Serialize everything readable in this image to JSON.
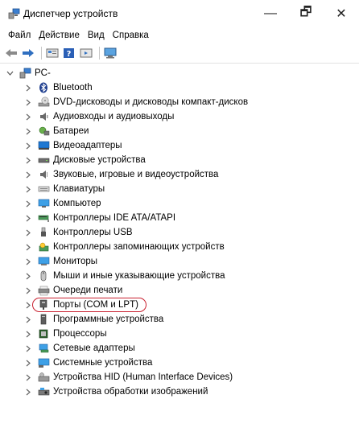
{
  "window": {
    "title": "Диспетчер устройств",
    "controls": {
      "minimize": "—",
      "maximize": "🗗",
      "close": "✕"
    }
  },
  "menu": [
    "Файл",
    "Действие",
    "Вид",
    "Справка"
  ],
  "toolbar": {
    "icons": [
      "back-arrow-icon",
      "forward-arrow-icon",
      "properties-icon",
      "help-icon",
      "update-driver-icon",
      "scan-hardware-icon"
    ]
  },
  "tree": {
    "root": {
      "label": "PC-",
      "expanded": true
    },
    "items": [
      {
        "label": "Bluetooth",
        "icon": "bluetooth-icon"
      },
      {
        "label": "DVD-дисководы и дисководы компакт-дисков",
        "icon": "dvd-drive-icon"
      },
      {
        "label": "Аудиовходы и аудиовыходы",
        "icon": "speaker-icon"
      },
      {
        "label": "Батареи",
        "icon": "battery-icon"
      },
      {
        "label": "Видеоадаптеры",
        "icon": "display-adapter-icon"
      },
      {
        "label": "Дисковые устройства",
        "icon": "disk-drive-icon"
      },
      {
        "label": "Звуковые, игровые и видеоустройства",
        "icon": "sound-device-icon"
      },
      {
        "label": "Клавиатуры",
        "icon": "keyboard-icon"
      },
      {
        "label": "Компьютер",
        "icon": "computer-icon"
      },
      {
        "label": "Контроллеры IDE ATA/ATAPI",
        "icon": "ide-controller-icon"
      },
      {
        "label": "Контроллеры USB",
        "icon": "usb-icon"
      },
      {
        "label": "Контроллеры запоминающих устройств",
        "icon": "storage-controller-icon"
      },
      {
        "label": "Мониторы",
        "icon": "monitor-icon"
      },
      {
        "label": "Мыши и иные указывающие устройства",
        "icon": "mouse-icon"
      },
      {
        "label": "Очереди печати",
        "icon": "printer-icon"
      },
      {
        "label": "Порты (COM и LPT)",
        "icon": "port-icon",
        "highlighted": true
      },
      {
        "label": "Программные устройства",
        "icon": "software-device-icon"
      },
      {
        "label": "Процессоры",
        "icon": "processor-icon"
      },
      {
        "label": "Сетевые адаптеры",
        "icon": "network-adapter-icon"
      },
      {
        "label": "Системные устройства",
        "icon": "system-device-icon"
      },
      {
        "label": "Устройства HID (Human Interface Devices)",
        "icon": "hid-icon"
      },
      {
        "label": "Устройства обработки изображений",
        "icon": "imaging-device-icon"
      }
    ]
  },
  "colors": {
    "highlight": "#c9202f",
    "accent": "#1e78d2"
  }
}
